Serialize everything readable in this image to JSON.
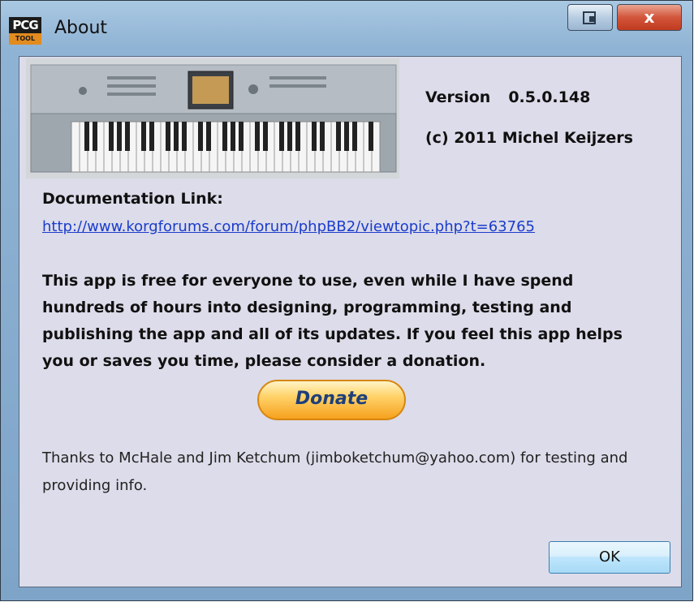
{
  "window": {
    "title": "About",
    "app_icon": {
      "top_text": "PCG",
      "bottom_text": "TOOL"
    },
    "controls": {
      "restore_icon": "restore-icon",
      "close_glyph": "x"
    }
  },
  "header": {
    "version_label": "Version",
    "version_value": "0.5.0.148",
    "copyright": "(c) 2011 Michel Keijzers",
    "image": "keyboard-synthesizer-image"
  },
  "documentation": {
    "label": "Documentation Link:",
    "url": "http://www.korgforums.com/forum/phpBB2/viewtopic.php?t=63765"
  },
  "notice": "This app is free for everyone to use, even while I have spend hundreds of hours into designing, programming, testing and publishing the app and all of its updates. If you feel this app helps you or saves you time, please consider a donation.",
  "donate_label": "Donate",
  "thanks": "Thanks to McHale and Jim Ketchum (jimboketchum@yahoo.com) for testing and providing info.",
  "ok_label": "OK",
  "colors": {
    "link": "#1a3ccc",
    "client_bg": "#dcdcea",
    "frame": "#8fb3d4",
    "close": "#c03b1f"
  }
}
